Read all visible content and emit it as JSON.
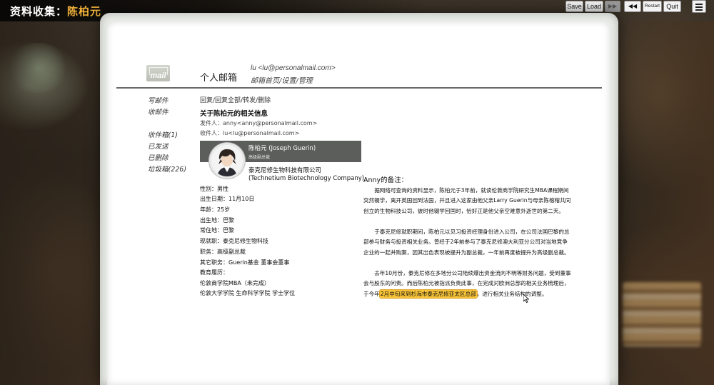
{
  "header": {
    "title_prefix": "资料收集：",
    "title_name": "陈柏元"
  },
  "controls": {
    "save": "Save",
    "load": "Load",
    "ffwd": "▶▶",
    "rewind": "◀◀",
    "restart": "Restart",
    "quit": "Quit",
    "menu_icon": "hamburger-menu-icon"
  },
  "mail": {
    "logo_text": "mail",
    "title": "个人邮箱",
    "user": "lu <lu@personalmail.com>",
    "path": "邮箱首页/设置/管理",
    "sidebar": [
      "写邮件",
      "收邮件",
      "收件箱(1)",
      "已发送",
      "已删除",
      "垃圾箱(226)"
    ],
    "actions": "回复/回复全部/转发/删除",
    "subject": "关于陈柏元的相关信息",
    "from": "发件人：anny<anny@personalmail.com>",
    "to": "收件人：lu<lu@personalmail.com>"
  },
  "profile": {
    "name": "陈柏元 (Joseph Guerin)",
    "role": "高级副总裁",
    "company_cn": "泰克尼修生物科技有限公司",
    "company_en": "(Technetium Biotechnology Company)",
    "fields": [
      "性别：男性",
      "出生日期：11月10日",
      "年龄：25岁",
      "出生地：巴黎",
      "常住地：巴黎",
      "现就职：泰克尼修生物科技",
      "职务：高级副总裁",
      "其它职务：Guerin基金 董事会董事",
      "教育履历：",
      "伦敦商学院MBA（未完成）",
      "伦敦大学学院 生命科学学院 学士学位"
    ]
  },
  "note": {
    "title": "Anny的备注：",
    "p1": "据网络可查询的资料显示，陈柏元于3年前，就读伦敦商学院研究生MBA课程期间突然辍学，离开英国回到法国，并且进入这家由他父亲Larry Guerin与母亲陈榕榕共同创立的生物科技公司，彼时他辍学回国时，恰好正是他父亲空难意外逝世的第二天。",
    "p2": "于泰克尼修就职期间，陈柏元以见习投资经理身份进入公司，在公司法国巴黎的总部参与财务与投资相关业务。曾经于2年前参与了泰克尼修澳大利亚分公司对当地竞争企业的一起并购案，因其出色表现被提升为副总裁，一年前再度被提升为高级副总裁。",
    "p3_before": "去年10月份，泰克尼修在多地分公司陆续爆出资金流向不明等财务问题，受到董事会与股东的问责。而后陈柏元被指派负责此事，在完成对欧洲总部的相关业务梳理后，于今年",
    "p3_highlight": "2月中旬来到杉海市泰克尼修亚太区总部",
    "p3_after": "，进行相关业务结构的调整。"
  }
}
